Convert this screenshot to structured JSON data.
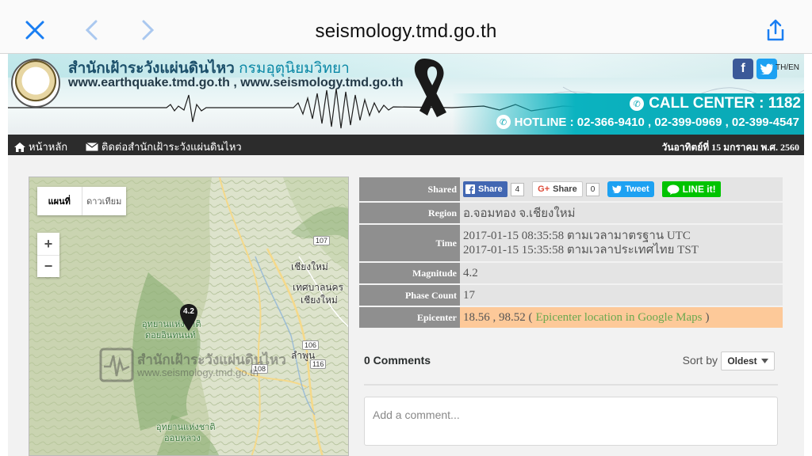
{
  "browser": {
    "url": "seismology.tmd.go.th",
    "close_icon": "close-icon",
    "back_icon": "chevron-left-icon",
    "forward_icon": "chevron-right-icon",
    "share_icon": "share-icon"
  },
  "banner": {
    "title_main": "สำนักเฝ้าระวังแผ่นดินไหว",
    "title_dept": "กรมอุตุนิยมวิทยา",
    "urls": "www.earthquake.tmd.go.th , www.seismology.tmd.go.th",
    "lang": "TH/EN",
    "call_center": "CALL CENTER : 1182",
    "hotline": "HOTLINE : 02-366-9410 , 02-399-0969 , 02-399-4547"
  },
  "nav": {
    "home": "หน้าหลัก",
    "contact": "ติดต่อสำนักเฝ้าระวังแผ่นดินไหว",
    "date": "วันอาทิตย์ที่ 15 มกราคม พ.ศ. 2560"
  },
  "map": {
    "type_map": "แผนที่",
    "type_satellite": "ดาวเทียม",
    "zoom_in": "+",
    "zoom_out": "−",
    "marker_value": "4.2",
    "labels": {
      "chiangmai": "เชียงใหม่",
      "tesaban": "เทศบาลนคร",
      "chiangmai2": "เชียงใหม่",
      "lamphun": "ลำพูน",
      "park1a": "อุทยานแห่งชาติ",
      "park1b": "ดอยอินทนนท์",
      "park2a": "อุทยานแห่งชาติ",
      "park2b": "ออบหลวง"
    },
    "shields": {
      "r107": "107",
      "r106": "106",
      "r116": "116",
      "r108": "108"
    },
    "watermark_text": "สำนักเฝ้าระวังแผ่นดินไหว",
    "watermark_url": "www.seismology.tmd.go.th"
  },
  "info": {
    "shared_label": "Shared",
    "fb_share": "Share",
    "fb_count": "4",
    "gplus_share": "Share",
    "gplus_count": "0",
    "tweet": "Tweet",
    "line": "LINE it!",
    "region_label": "Region",
    "region_value": "อ.จอมทอง จ.เชียงใหม่",
    "time_label": "Time",
    "time_utc": "2017-01-15 08:35:58 ตามเวลามาตรฐาน UTC",
    "time_tst": "2017-01-15 15:35:58 ตามเวลาประเทศไทย TST",
    "magnitude_label": "Magnitude",
    "magnitude_value": "4.2",
    "phase_label": "Phase Count",
    "phase_value": "17",
    "epicenter_label": "Epicenter",
    "epicenter_value": "18.56 , 98.52 (",
    "epicenter_link": "Epicenter location in Google Maps",
    "epicenter_close": ")"
  },
  "comments": {
    "count": "0 Comments",
    "sort_by": "Sort by",
    "sort_value": "Oldest",
    "placeholder": "Add a comment..."
  }
}
